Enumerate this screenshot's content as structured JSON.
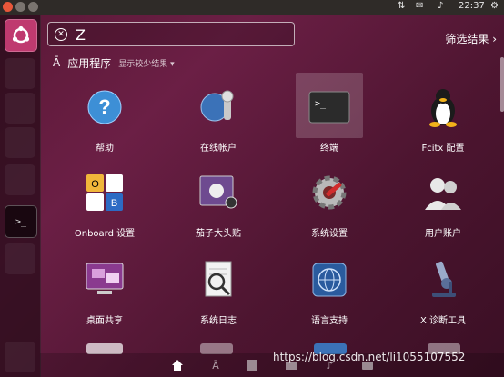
{
  "topbar": {
    "clock": "22:37",
    "tray_icons": [
      "network-icon",
      "mail-icon",
      "volume-icon",
      "power-icon"
    ]
  },
  "search": {
    "value": "Z",
    "clear_icon": "close-icon"
  },
  "filter": {
    "label": "筛选结果"
  },
  "category": {
    "title": "应用程序",
    "more": "显示较少结果"
  },
  "apps": [
    {
      "label": "帮助",
      "icon": "help-icon"
    },
    {
      "label": "在线帐户",
      "icon": "online-accounts-icon"
    },
    {
      "label": "终端",
      "icon": "terminal-icon"
    },
    {
      "label": "Fcitx 配置",
      "icon": "tux-icon"
    },
    {
      "label": "Onboard 设置",
      "icon": "keyboard-settings-icon"
    },
    {
      "label": "茄子大头贴",
      "icon": "cheese-icon"
    },
    {
      "label": "系统设置",
      "icon": "gear-icon"
    },
    {
      "label": "用户账户",
      "icon": "users-icon"
    },
    {
      "label": "桌面共享",
      "icon": "desktop-share-icon"
    },
    {
      "label": "系统日志",
      "icon": "log-icon"
    },
    {
      "label": "语言支持",
      "icon": "globe-icon"
    },
    {
      "label": "X 诊断工具",
      "icon": "microscope-icon"
    }
  ],
  "lenses": [
    "home-icon",
    "apps-icon",
    "files-icon",
    "video-icon",
    "music-icon",
    "photo-icon"
  ],
  "watermark": "https://blog.csdn.net/li1055107552",
  "colors": {
    "dash_accent": "#bf3a6f",
    "background": "#5a1836"
  }
}
